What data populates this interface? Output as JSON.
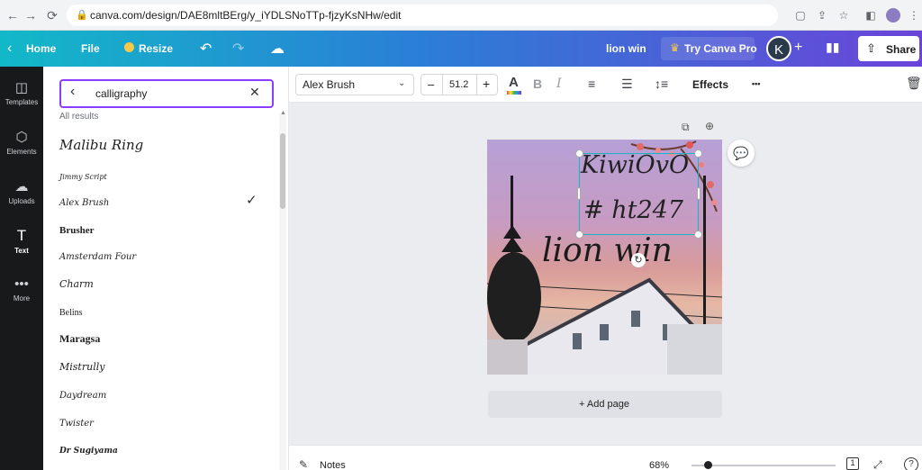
{
  "browser": {
    "url": "canva.com/design/DAE8mltBErg/y_iYDLSNoTTp-fjzyKsNHw/edit"
  },
  "header": {
    "home_label": "Home",
    "file_label": "File",
    "resize_label": "Resize",
    "doc_title": "lion win",
    "try_pro_label": "Try Canva Pro",
    "avatar_letter": "K",
    "share_label": "Share"
  },
  "rail": {
    "items": [
      {
        "label": "Templates"
      },
      {
        "label": "Elements"
      },
      {
        "label": "Uploads"
      },
      {
        "label": "Text"
      },
      {
        "label": "More"
      }
    ]
  },
  "fonts_panel": {
    "search_value": "calligraphy",
    "results_heading": "All results",
    "fonts": [
      {
        "name": "Malibu Ring"
      },
      {
        "name": "Jimmy Script"
      },
      {
        "name": "Alex Brush",
        "selected": true
      },
      {
        "name": "Brusher"
      },
      {
        "name": "Amsterdam Four"
      },
      {
        "name": "Charm"
      },
      {
        "name": "Belins"
      },
      {
        "name": "Maragsa"
      },
      {
        "name": "Mistrully"
      },
      {
        "name": "Daydream"
      },
      {
        "name": "Twister"
      },
      {
        "name": "Dr Sugiyama"
      }
    ]
  },
  "toolbar": {
    "font_family": "Alex Brush",
    "minus_label": "–",
    "font_size": "51.2",
    "plus_label": "+",
    "text_color_label": "A",
    "bold_label": "B",
    "italic_label": "I",
    "effects_label": "Effects",
    "more_label": "•••"
  },
  "canvas": {
    "text_line1": "KiwiOvO",
    "text_line2": "# ht247",
    "text_line3": "lion win",
    "add_page_label": "+ Add page"
  },
  "footer": {
    "notes_label": "Notes",
    "zoom_value": "68%",
    "zoom_level": 0.2,
    "page_number": "1",
    "help_label": "?"
  },
  "colors": {
    "header_start": "#12b8c8",
    "header_end": "#6a44d8",
    "accent_purple": "#8b3dff",
    "crown": "#f7c948"
  }
}
